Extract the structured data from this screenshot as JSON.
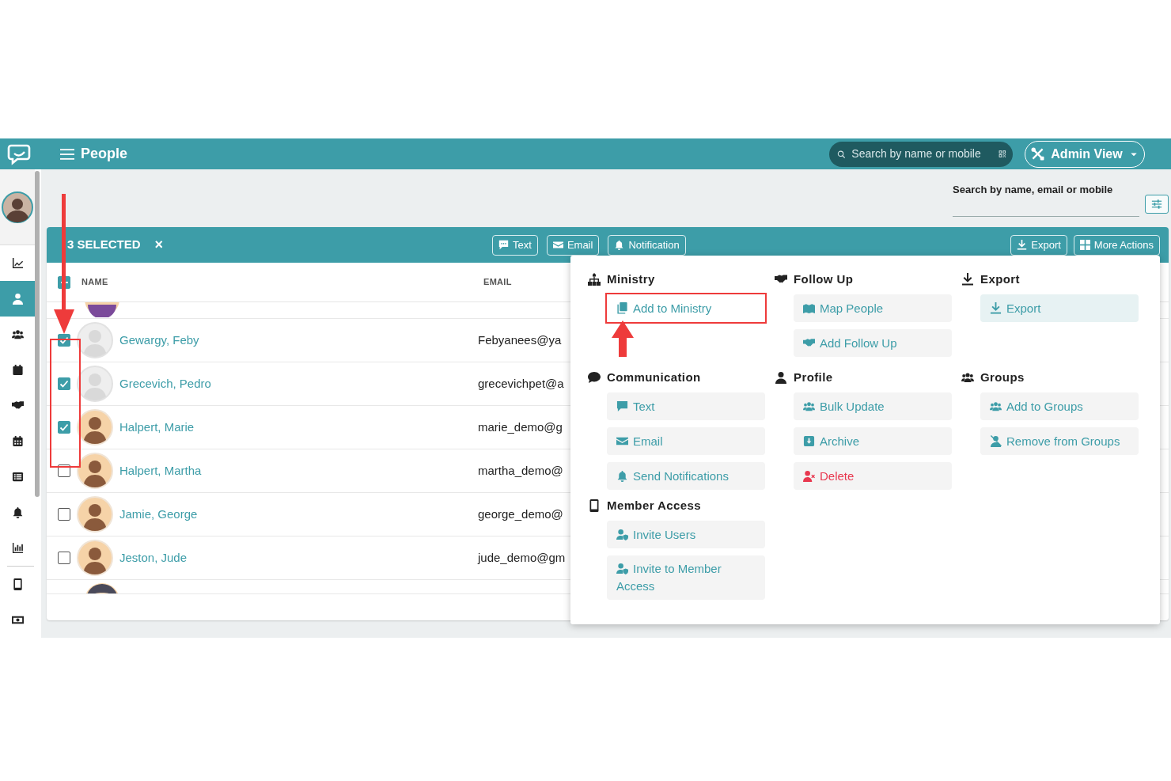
{
  "app": {
    "title": "People",
    "search_placeholder": "Search by name or mobile",
    "view_menu": "Admin View"
  },
  "sidebar": {
    "items": [
      {
        "selected": false
      },
      {
        "selected": true
      },
      {
        "selected": false
      },
      {
        "selected": false
      },
      {
        "selected": false
      },
      {
        "selected": false
      },
      {
        "selected": false
      },
      {
        "selected": false
      },
      {
        "selected": false
      },
      {
        "selected": false
      },
      {
        "selected": false
      }
    ]
  },
  "filter": {
    "label": "Search by name, email or mobile"
  },
  "selection_bar": {
    "count": "3 SELECTED",
    "close": "×",
    "actions": [
      "Text",
      "Email",
      "Notification"
    ],
    "right_actions": [
      "Export",
      "More Actions"
    ]
  },
  "table": {
    "columns": [
      "NAME",
      "EMAIL"
    ],
    "header_indeterminate": true,
    "annotated": true,
    "rows": [
      {
        "name": "Gewargy, Feby",
        "email": "Febyanees@ya",
        "checked": true,
        "placeholder_avatar": true
      },
      {
        "name": "Grecevich, Pedro",
        "email": "grecevichpet@a",
        "checked": true,
        "placeholder_avatar": true
      },
      {
        "name": "Halpert, Marie",
        "email": "marie_demo@g",
        "checked": true,
        "placeholder_avatar": false
      },
      {
        "name": "Halpert, Martha",
        "email": "martha_demo@",
        "checked": false,
        "placeholder_avatar": false
      },
      {
        "name": "Jamie, George",
        "email": "george_demo@",
        "checked": false,
        "placeholder_avatar": false
      },
      {
        "name": "Jeston, Jude",
        "email": "jude_demo@gm",
        "checked": false,
        "placeholder_avatar": false
      }
    ]
  },
  "menu": {
    "sections": [
      {
        "title": "Ministry",
        "items": [
          {
            "label": "Add to Ministry",
            "kind": "normal",
            "highlighted": false,
            "annotated": true
          }
        ]
      },
      {
        "title": "Follow Up",
        "items": [
          {
            "label": "Map People",
            "kind": "normal",
            "highlighted": false,
            "annotated": false
          },
          {
            "label": "Add Follow Up",
            "kind": "normal",
            "highlighted": false,
            "annotated": false
          }
        ]
      },
      {
        "title": "Export",
        "items": [
          {
            "label": "Export",
            "kind": "normal",
            "highlighted": true,
            "annotated": false
          }
        ]
      },
      {
        "title": "Communication",
        "items": [
          {
            "label": "Text",
            "kind": "normal",
            "highlighted": false,
            "annotated": false
          },
          {
            "label": "Email",
            "kind": "normal",
            "highlighted": false,
            "annotated": false
          },
          {
            "label": "Send Notifications",
            "kind": "normal",
            "highlighted": false,
            "annotated": false
          }
        ]
      },
      {
        "title": "Profile",
        "items": [
          {
            "label": "Bulk Update",
            "kind": "normal",
            "highlighted": false,
            "annotated": false
          },
          {
            "label": "Archive",
            "kind": "normal",
            "highlighted": false,
            "annotated": false
          },
          {
            "label": "Delete",
            "kind": "danger",
            "highlighted": false,
            "annotated": false
          }
        ]
      },
      {
        "title": "Groups",
        "items": [
          {
            "label": "Add to Groups",
            "kind": "normal",
            "highlighted": false,
            "annotated": false
          },
          {
            "label": "Remove from Groups",
            "kind": "normal",
            "highlighted": false,
            "annotated": false
          }
        ]
      },
      {
        "title": "Member Access",
        "items": [
          {
            "label": "Invite Users",
            "kind": "normal",
            "highlighted": false,
            "annotated": false
          },
          {
            "label": "Invite to Member Access",
            "kind": "normal",
            "highlighted": false,
            "annotated": false
          }
        ]
      }
    ]
  }
}
